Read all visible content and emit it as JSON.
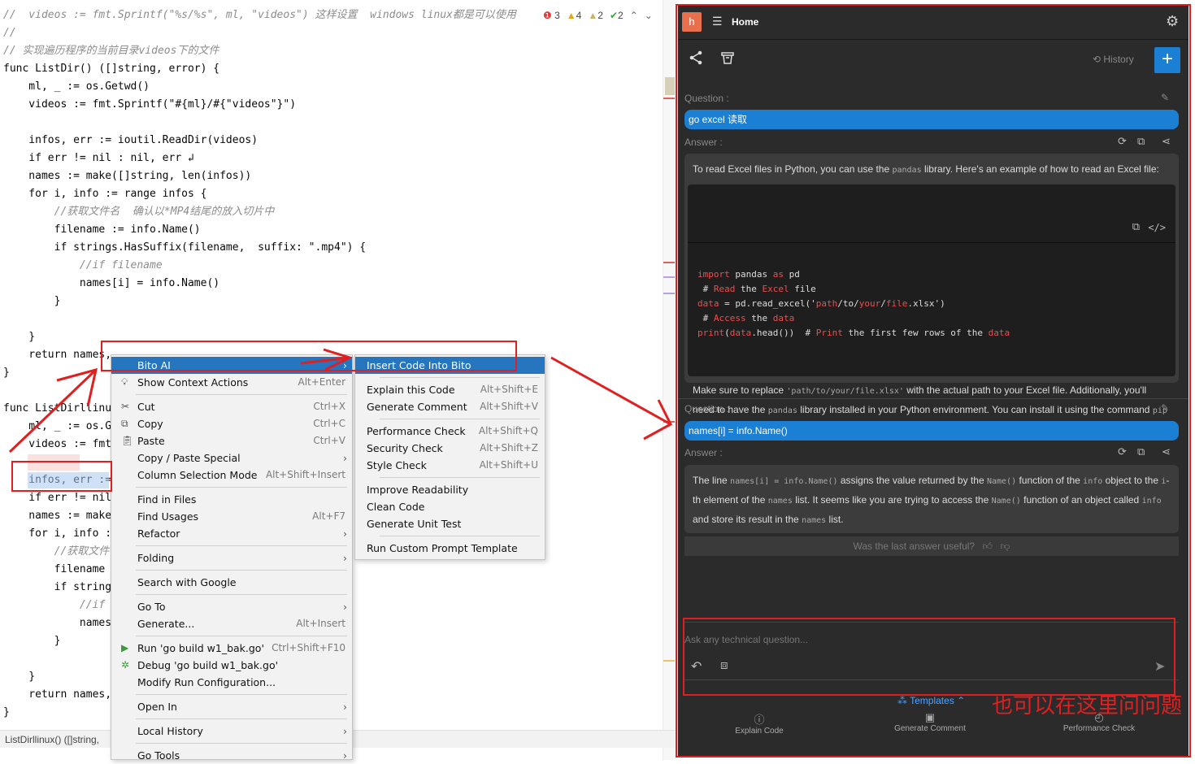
{
  "editor": {
    "lines": [
      {
        "t": "//  videos := fmt.Sprintf(\"%s/%s\", ml, \"videos\") 这样设置  windows linux都是可以使用",
        "k": "cmt"
      },
      {
        "t": "//",
        "k": "cmt"
      },
      {
        "t": "// 实现遍历程序的当前目录videos下的文件",
        "k": "cmt"
      },
      {
        "t": "func ListDir() ([]string, error) {"
      },
      {
        "t": "    ml, _ := os.Getwd()"
      },
      {
        "t": "    videos := fmt.Sprintf(\"#{ml}/#{\"videos\"}\")"
      },
      {
        "t": ""
      },
      {
        "t": "    infos, err := ioutil.ReadDir(videos)"
      },
      {
        "t": "    if err != nil : nil, err ↲"
      },
      {
        "t": "    names := make([]string, len(infos))"
      },
      {
        "t": "    for i, info := range infos {"
      },
      {
        "t": "        //获取文件名  确认以*MP4结尾的放入切片中",
        "k": "cmt"
      },
      {
        "t": "        filename := info.Name()"
      },
      {
        "t": "        if strings.HasSuffix(filename,  suffix: \".mp4\") {"
      },
      {
        "t": "            //if filename",
        "k": "cmt"
      },
      {
        "t": "            names[i] = info.Name()"
      },
      {
        "t": "        }"
      },
      {
        "t": ""
      },
      {
        "t": "    }"
      },
      {
        "t": "    return names,"
      },
      {
        "t": "}"
      },
      {
        "t": ""
      },
      {
        "t": "func ListDirllinu"
      },
      {
        "t": "    ml, _ := os.G"
      },
      {
        "t": "    videos := fmt"
      },
      {
        "t": ""
      },
      {
        "t": "    infos, err :="
      },
      {
        "t": "    if err != nil"
      },
      {
        "t": "    names := make"
      },
      {
        "t": "    for i, info :"
      },
      {
        "t": "        //获取文件",
        "k": "cmt"
      },
      {
        "t": "        filename"
      },
      {
        "t": "        if string"
      },
      {
        "t": "            //if",
        "k": "cmt"
      },
      {
        "t": "            names"
      },
      {
        "t": "        }"
      },
      {
        "t": ""
      },
      {
        "t": "    }"
      },
      {
        "t": "    return names,"
      },
      {
        "t": "}"
      }
    ],
    "inspections": {
      "errors": "3",
      "warnings": "4",
      "weak": "2",
      "ok": "2"
    },
    "status": "ListDirllinux() ([]string,"
  },
  "context_menu": [
    {
      "label": "Bito AI",
      "arrow": true,
      "selected": true
    },
    {
      "label": "Show Context Actions",
      "shortcut": "Alt+Enter",
      "icon": "lightbulb-icon"
    },
    {
      "sep": true
    },
    {
      "label": "Cut",
      "shortcut": "Ctrl+X",
      "icon": "scissors-icon"
    },
    {
      "label": "Copy",
      "shortcut": "Ctrl+C",
      "icon": "copy-icon"
    },
    {
      "label": "Paste",
      "shortcut": "Ctrl+V",
      "icon": "clipboard-icon"
    },
    {
      "label": "Copy / Paste Special",
      "arrow": true
    },
    {
      "label": "Column Selection Mode",
      "shortcut": "Alt+Shift+Insert"
    },
    {
      "sep": true
    },
    {
      "label": "Find in Files"
    },
    {
      "label": "Find Usages",
      "shortcut": "Alt+F7"
    },
    {
      "label": "Refactor",
      "arrow": true
    },
    {
      "sep": true
    },
    {
      "label": "Folding",
      "arrow": true
    },
    {
      "sep": true
    },
    {
      "label": "Search with Google"
    },
    {
      "sep": true
    },
    {
      "label": "Go To",
      "arrow": true
    },
    {
      "label": "Generate...",
      "shortcut": "Alt+Insert"
    },
    {
      "sep": true
    },
    {
      "label": "Run 'go build w1_bak.go'",
      "shortcut": "Ctrl+Shift+F10",
      "icon": "run-icon"
    },
    {
      "label": "Debug 'go build w1_bak.go'",
      "icon": "debug-icon"
    },
    {
      "label": "Modify Run Configuration..."
    },
    {
      "sep": true
    },
    {
      "label": "Open In",
      "arrow": true
    },
    {
      "sep": true
    },
    {
      "label": "Local History",
      "arrow": true
    },
    {
      "sep": true
    },
    {
      "label": "Go Tools",
      "arrow": true
    }
  ],
  "bito_menu": [
    {
      "label": "Insert Code Into Bito",
      "selected": true
    },
    {
      "sep": true
    },
    {
      "label": "Explain this Code",
      "shortcut": "Alt+Shift+E"
    },
    {
      "label": "Generate Comment",
      "shortcut": "Alt+Shift+V"
    },
    {
      "sep": true
    },
    {
      "label": "Performance Check",
      "shortcut": "Alt+Shift+Q"
    },
    {
      "label": "Security Check",
      "shortcut": "Alt+Shift+Z"
    },
    {
      "label": "Style Check",
      "shortcut": "Alt+Shift+U"
    },
    {
      "sep": true
    },
    {
      "label": "Improve Readability"
    },
    {
      "label": "Clean Code"
    },
    {
      "label": "Generate Unit Test"
    },
    {
      "sep": true
    },
    {
      "label": "Run Custom Prompt Template"
    }
  ],
  "bito": {
    "avatar": "h",
    "home": "Home",
    "history": "History",
    "question_label": "Question :",
    "answer_label": "Answer :",
    "q1": "go excel 读取",
    "a1_p1_a": "To read Excel files in Python, you can use the",
    "a1_p1_code": "pandas",
    "a1_p1_b": "library. Here's an example of how to read an Excel file:",
    "a1_code": [
      "import pandas as pd",
      " # Read the Excel file",
      "data = pd.read_excel('path/to/your/file.xlsx')",
      " # Access the data",
      "print(data.head())  # Print the first few rows of the data"
    ],
    "a1_p2_a": "Make sure to replace",
    "a1_p2_code": "'path/to/your/file.xlsx'",
    "a1_p2_b": "with the actual path to your Excel file. Additionally, you'll need to have the",
    "a1_p2_code2": "pandas",
    "a1_p2_c": "library installed in your Python environment. You can install it using the command",
    "a1_p2_code3": "pip install pandas",
    "q2": "names[i] = info.Name()",
    "a2_a": "The line",
    "a2_c1": "names[i] = info.Name()",
    "a2_b": "assigns the value returned by the",
    "a2_c2": "Name()",
    "a2_c": "function of the",
    "a2_c3": "info",
    "a2_d": "object to the",
    "a2_c4": "i",
    "a2_e": "-th element of the",
    "a2_c5": "names",
    "a2_f": "list. It seems like you are trying to access the",
    "a2_c6": "Name()",
    "a2_g": "function of an object called",
    "a2_c7": "info",
    "a2_h": "and store its result in the",
    "a2_c8": "names",
    "a2_i": "list.",
    "feedback": "Was the last answer useful?",
    "input_placeholder": "Ask any technical question...",
    "templates": "Templates",
    "footer": [
      "Explain Code",
      "Generate Comment",
      "Performance Check"
    ]
  },
  "annotation_text": "也可以在这里问问题",
  "colors": {
    "accent": "#1b7fd4",
    "annotation": "#e02020",
    "menu_selected": "#2675bf",
    "panel_bg": "#2b2b2b"
  }
}
